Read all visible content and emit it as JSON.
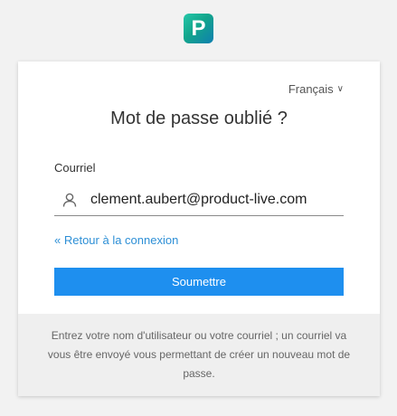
{
  "logo": {
    "letter": "P"
  },
  "language": {
    "selected": "Français",
    "chevron": "chevron-down-icon"
  },
  "title": "Mot de passe oublié ?",
  "email": {
    "label": "Courriel",
    "value": "clement.aubert@product-live.com",
    "icon": "user-icon"
  },
  "back_link": "« Retour à la connexion",
  "submit_label": "Soumettre",
  "help_text": "Entrez votre nom d'utilisateur ou votre courriel ; un courriel va vous être envoyé vous permettant de créer un nouveau mot de passe.",
  "colors": {
    "accent": "#1e8fef",
    "link": "#2d8fd6",
    "logo_gradient": [
      "#25c7a8",
      "#0f7fb0"
    ],
    "background": "#f2f2f2",
    "footer_bg": "#efefef"
  }
}
